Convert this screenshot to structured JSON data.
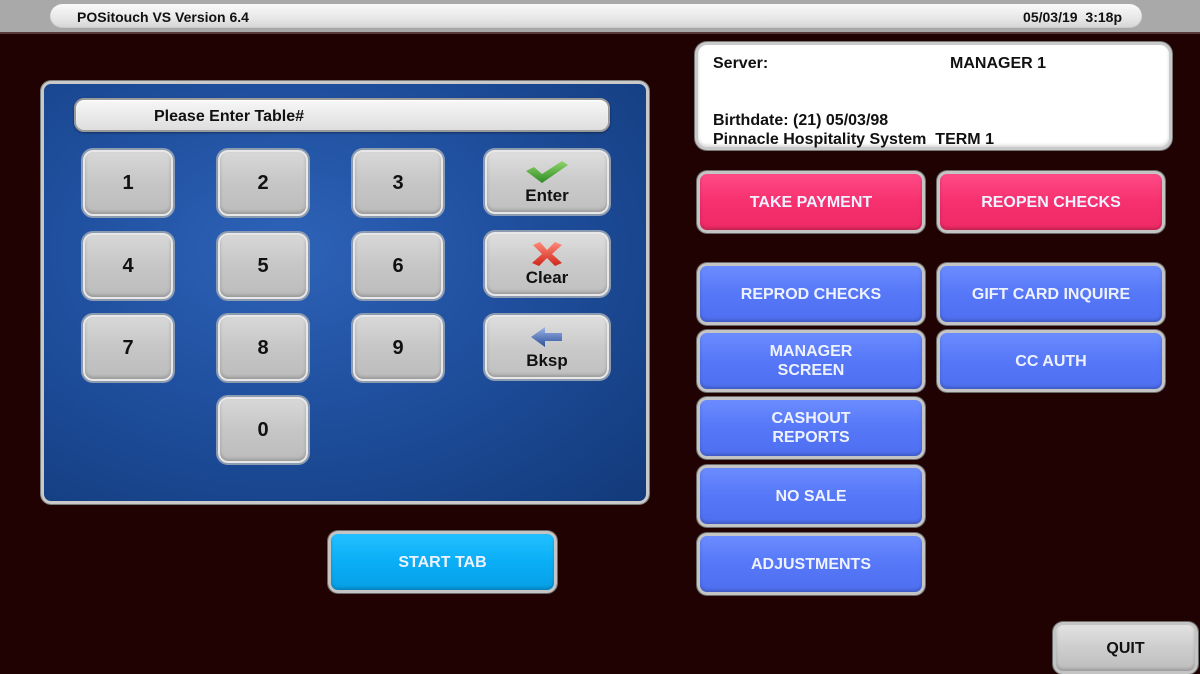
{
  "titlebar": {
    "app_title": "POSitouch VS Version 6.4",
    "datetime": "05/03/19  3:18p"
  },
  "keypad": {
    "prompt": "Please Enter Table#",
    "digits": [
      "1",
      "2",
      "3",
      "4",
      "5",
      "6",
      "7",
      "8",
      "9",
      "0"
    ],
    "function_keys": [
      {
        "label": "Enter",
        "icon": "checkmark-icon"
      },
      {
        "label": "Clear",
        "icon": "x-icon"
      },
      {
        "label": "Bksp",
        "icon": "arrow-left-icon"
      }
    ]
  },
  "info": {
    "server_label": "Server:",
    "server_name": "MANAGER 1",
    "birthdate": "Birthdate: (21) 05/03/98",
    "system_line": "Pinnacle Hospitality System  TERM 1"
  },
  "actions": {
    "take_payment": "TAKE  PAYMENT",
    "reopen_checks": "REOPEN CHECKS",
    "reprod_checks": "REPROD CHECKS",
    "gift_card_inquire": "GIFT CARD INQUIRE",
    "manager_screen": "MANAGER\nSCREEN",
    "cc_auth": "CC AUTH",
    "cashout_reports": "CASHOUT\nREPORTS",
    "no_sale": "NO SALE",
    "adjustments": "ADJUSTMENTS",
    "start_tab": "START TAB",
    "quit": "QUIT"
  },
  "colors": {
    "background": "#1f0201",
    "pink_button": "#f7306f",
    "blue_button": "#5677f7",
    "cyan_button": "#0aaef6",
    "keypad_panel": "#1f4f9e"
  }
}
